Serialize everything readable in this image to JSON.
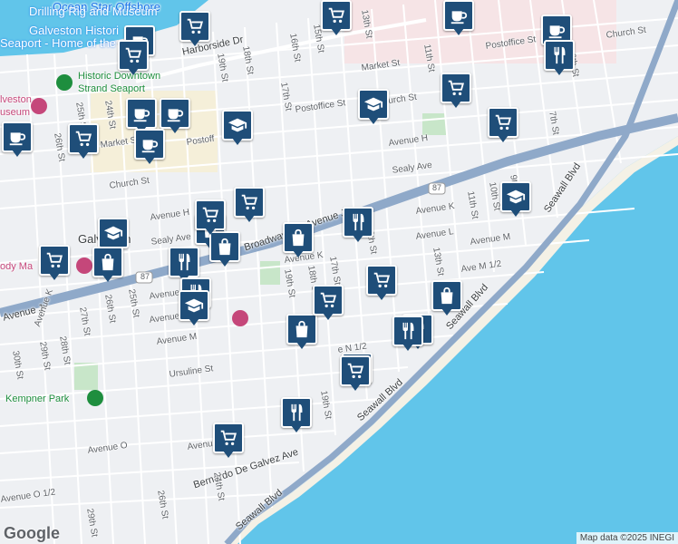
{
  "map": {
    "water_color": "#61c5ea",
    "land_color": "#eef0f3",
    "highway_color": "#8fa9c9",
    "marker_color": "#1f4e79"
  },
  "places": {
    "ocean_star": "Ocean Star Offshore",
    "drilling_rig": "Drilling Rig and Museum",
    "galveston_historic": "Galveston Histori",
    "seaport_home": "Seaport - Home of the",
    "historic_downtown": "Historic Downtown",
    "strand_seaport": "Strand Seaport",
    "galveston_museum_1": "lveston",
    "galveston_museum_2": "useum",
    "galveston_city": "Galveston",
    "kempner_park": "Kempner Park",
    "moody_ma": "ody Ma"
  },
  "roads": {
    "harborside": "Harborside Dr",
    "market_st": "Market St",
    "market_st_2": "Market St",
    "postoffice_st": "Postoffice St",
    "postoffice_st_2": "Postoffice St",
    "postoffice_st_3": "Postoff",
    "church_st": "Church St",
    "church_st_2": "Church St",
    "church_st_3": "Church St",
    "avenue_h": "Avenue H",
    "avenue_h_2": "Avenue H",
    "sealy_ave": "Sealy Ave",
    "sealy_ave_2": "Sealy Ave",
    "broadway": "Broadway",
    "avenue_j": "Avenue J",
    "avenue_j_2": "Avenue J",
    "avenue_k": "Avenue K",
    "avenue_k_2": "Avenue K",
    "avenue_k_3": "Avenue K",
    "avenue_l": "Avenue L",
    "avenue_l_2": "Avenue L",
    "avenue_m": "Avenue M",
    "avenue_m_2": "Avenue M",
    "avenue_m_3": "Avenue M",
    "ave_m_half": "Ave M 1/2",
    "avenue_n_half": "e N 1/2",
    "avenue_o": "Avenue O",
    "avenue_o_2": "Avenue",
    "avenue_o_half": "Avenue O 1/2",
    "ursuline": "Ursuline St",
    "bernardo": "Bernardo De Galvez Ave",
    "seawall_1": "Seawall Blvd",
    "seawall_2": "Seawall Blvd",
    "seawall_3": "Seawall Blvd",
    "seawall_4": "Seawall Blvd",
    "hwy_87": "87",
    "st_6th": "6th St",
    "st_7th": "7th St",
    "st_9th": "9th St",
    "st_10th": "10th St",
    "st_11th": "11th St",
    "st_11th_2": "11th St",
    "st_12th": "12th St",
    "st_13th": "13th St",
    "st_13th_2": "13th St",
    "st_15th": "15th St",
    "st_16th": "16th St",
    "st_17th": "17th St",
    "st_17th_2": "17th St",
    "st_18th": "18th St",
    "st_18th_2": "18th St",
    "st_19th": "19th St",
    "st_19th_2": "19th St",
    "st_19th_3": "19th St",
    "st_24th": "24th St",
    "st_24th_2": "24th St",
    "st_25th": "25th St",
    "st_25th_2": "25th St",
    "st_26th": "26th St",
    "st_26th_2": "26th St",
    "st_26th_3": "26th St",
    "st_27th": "27th St",
    "st_28th": "28th St",
    "st_29th": "29th St",
    "st_29th_2": "29th St",
    "st_30th": "30th St"
  },
  "markers": [
    {
      "icon": "shopping-cart-icon"
    },
    {
      "icon": "coffee-cup-icon"
    },
    {
      "icon": "shopping-cart-icon"
    },
    {
      "icon": "coffee-cup-icon"
    },
    {
      "icon": "coffee-cup-icon"
    },
    {
      "icon": "shopping-cart-icon"
    },
    {
      "icon": "restaurant-icon"
    },
    {
      "icon": "school-icon"
    },
    {
      "icon": "shopping-cart-icon"
    },
    {
      "icon": "coffee-cup-icon"
    },
    {
      "icon": "coffee-cup-icon"
    },
    {
      "icon": "shopping-cart-icon"
    },
    {
      "icon": "coffee-cup-icon"
    },
    {
      "icon": "shopping-cart-icon"
    },
    {
      "icon": "school-icon"
    },
    {
      "icon": "coffee-cup-icon"
    },
    {
      "icon": "shopping-cart-icon"
    },
    {
      "icon": "shopping-bag-icon"
    },
    {
      "icon": "shopping-bag-icon"
    },
    {
      "icon": "restaurant-icon"
    },
    {
      "icon": "shopping-cart-icon"
    },
    {
      "icon": "school-icon"
    },
    {
      "icon": "restaurant-icon"
    },
    {
      "icon": "school-icon"
    },
    {
      "icon": "shopping-bag-icon"
    },
    {
      "icon": "restaurant-icon"
    },
    {
      "icon": "shopping-cart-icon"
    },
    {
      "icon": "shopping-bag-icon"
    },
    {
      "icon": "restaurant-icon"
    },
    {
      "icon": "school-icon"
    },
    {
      "icon": "restaurant-icon"
    },
    {
      "icon": "shopping-bag-icon"
    },
    {
      "icon": "shopping-cart-icon"
    },
    {
      "icon": "shopping-bag-icon"
    },
    {
      "icon": "restaurant-icon"
    },
    {
      "icon": "shopping-cart-icon"
    },
    {
      "icon": "shopping-cart-icon"
    },
    {
      "icon": "restaurant-icon"
    },
    {
      "icon": "shopping-cart-icon"
    }
  ],
  "footer": {
    "logo": "Google",
    "attribution": "Map data ©2025 INEGI"
  }
}
